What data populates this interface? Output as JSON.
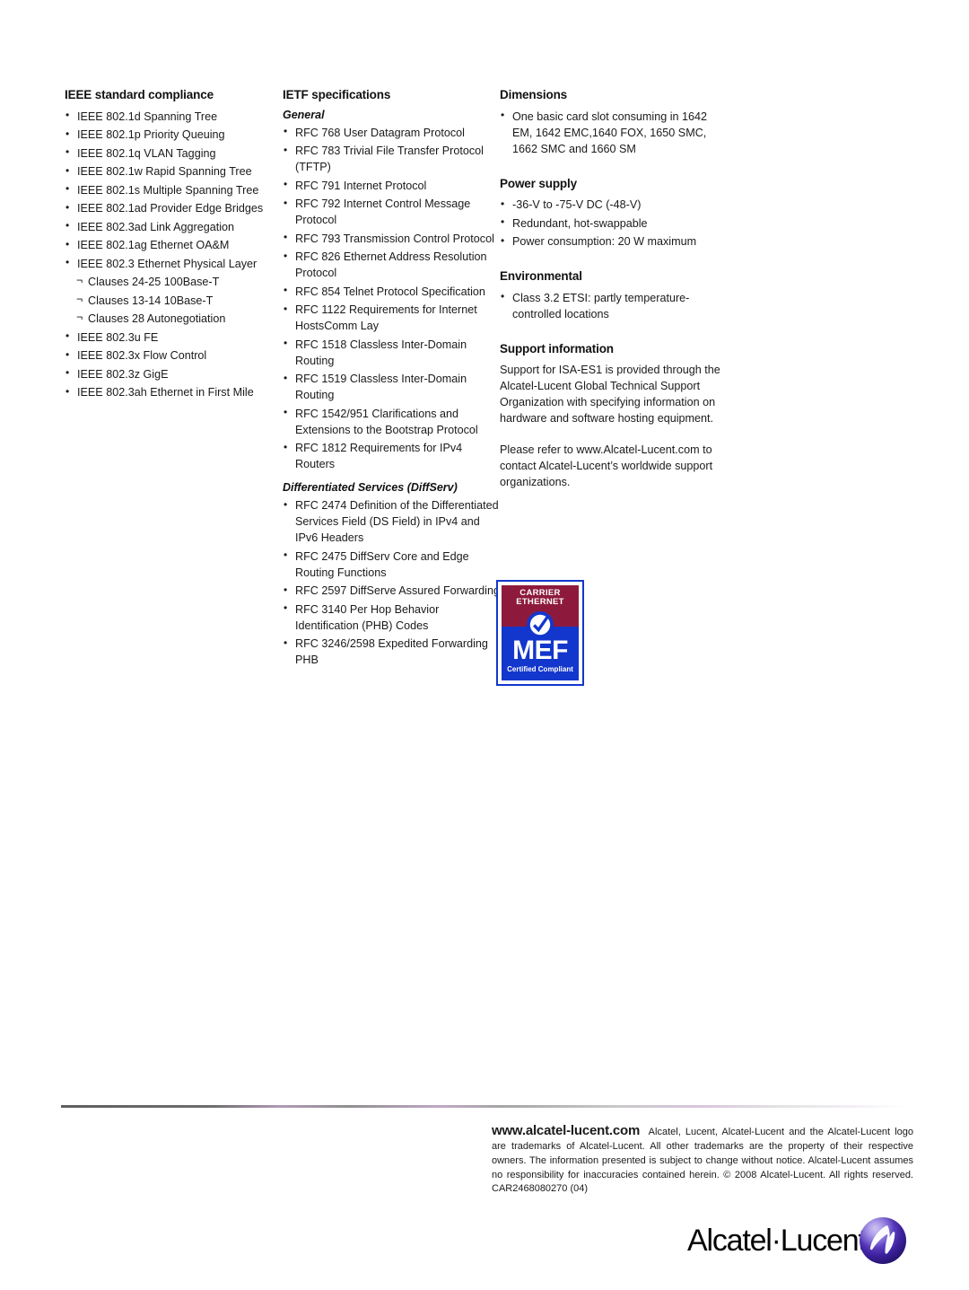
{
  "columns": {
    "ieee": {
      "heading": "IEEE standard compliance",
      "items": [
        {
          "text": "IEEE 802.1d Spanning Tree",
          "level": 1
        },
        {
          "text": "IEEE 802.1p Priority Queuing",
          "level": 1
        },
        {
          "text": "IEEE 802.1q VLAN Tagging",
          "level": 1
        },
        {
          "text": "IEEE 802.1w Rapid Spanning Tree",
          "level": 1
        },
        {
          "text": "IEEE 802.1s Multiple Spanning Tree",
          "level": 1
        },
        {
          "text": "IEEE 802.1ad Provider Edge Bridges",
          "level": 1
        },
        {
          "text": "IEEE 802.3ad Link Aggregation",
          "level": 1
        },
        {
          "text": "IEEE 802.1ag Ethernet OA&M",
          "level": 1
        },
        {
          "text": "IEEE 802.3 Ethernet Physical Layer",
          "level": 1
        },
        {
          "text": "Clauses 24-25 100Base-T",
          "level": 2
        },
        {
          "text": "Clauses 13-14 10Base-T",
          "level": 2
        },
        {
          "text": "Clauses 28 Autonegotiation",
          "level": 2
        },
        {
          "text": "IEEE 802.3u FE",
          "level": 1
        },
        {
          "text": "IEEE 802.3x Flow Control",
          "level": 1
        },
        {
          "text": "IEEE 802.3z GigE",
          "level": 1
        },
        {
          "text": "IEEE 802.3ah Ethernet in First Mile",
          "level": 1
        }
      ]
    },
    "ietf": {
      "heading": "IETF specifications",
      "general_heading": "General",
      "general_items": [
        "RFC 768 User Datagram Protocol",
        "RFC 783 Trivial File Transfer Protocol (TFTP)",
        "RFC 791 Internet Protocol",
        "RFC 792 Internet Control Message Protocol",
        "RFC 793 Transmission Control Protocol",
        "RFC 826 Ethernet Address Resolution Protocol",
        "RFC 854 Telnet Protocol Specification",
        "RFC 1122 Requirements for Internet HostsComm Lay",
        "RFC 1518 Classless Inter-Domain Routing",
        "RFC 1519 Classless Inter-Domain Routing",
        "RFC 1542/951 Clarifications and Extensions to the Bootstrap Protocol",
        "RFC 1812 Requirements for IPv4 Routers"
      ],
      "diffserv_heading": "Differentiated Services (DiffServ)",
      "diffserv_items": [
        "RFC 2474 Definition of the Differentiated Services Field (DS Field) in IPv4 and IPv6 Headers",
        "RFC 2475 DiffServ Core and Edge Routing Functions",
        "RFC 2597 DiffServe Assured Forwarding",
        "RFC 3140 Per Hop Behavior Identification (PHB) Codes",
        "RFC 3246/2598 Expedited Forwarding PHB"
      ]
    },
    "specs": {
      "dimensions_heading": "Dimensions",
      "dimensions_items": [
        "One basic card slot consuming in 1642 EM, 1642 EMC,1640 FOX, 1650 SMC, 1662 SMC and 1660 SM"
      ],
      "power_heading": "Power supply",
      "power_items": [
        "-36-V to -75-V DC (-48-V)",
        "Redundant, hot-swappable",
        "Power consumption: 20 W maximum"
      ],
      "environmental_heading": "Environmental",
      "environmental_items": [
        "Class 3.2 ETSI: partly temperature-controlled locations"
      ],
      "support_heading": "Support information",
      "support_paragraph_1": "Support for ISA-ES1 is provided through the Alcatel-Lucent Global Technical Support Organization with specifying information on hardware and software hosting equipment.",
      "support_paragraph_2": "Please refer to www.Alcatel-Lucent.com to contact Alcatel-Lucent’s worldwide support organizations."
    }
  },
  "mef_logo": {
    "carrier_line_1": "CARRIER",
    "carrier_line_2": "ETHERNET",
    "wordmark": "MEF",
    "certified": "Certified Compliant",
    "maroon": "#8d1a3d",
    "blue": "#1336cc"
  },
  "footer": {
    "url": "www.alcatel-lucent.com",
    "legal": "Alcatel, Lucent, Alcatel-Lucent and the Alcatel-Lucent logo are trademarks of Alcatel-Lucent. All other trademarks are the property of their respective owners. The information presented is subject to change without notice. Alcatel-Lucent assumes no responsibility for inaccuracies contained herein. © 2008 Alcatel-Lucent. All rights reserved. CAR2468080270 (04)"
  },
  "brand_logo": {
    "wordmark": "Alcatel·Lucent",
    "sphere_color_light": "#7a5fd6",
    "sphere_color_dark": "#241472"
  }
}
